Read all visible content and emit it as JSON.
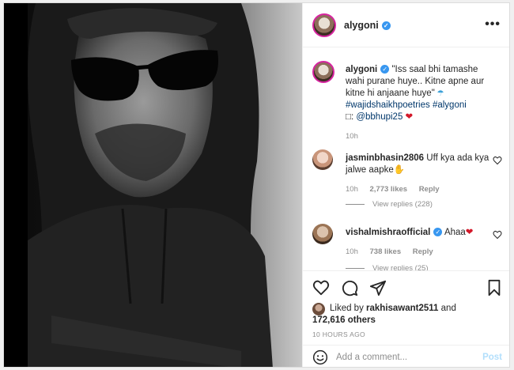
{
  "post": {
    "username": "alygoni",
    "more_icon": "more-dots-icon",
    "verified_icon": "verified-badge-icon"
  },
  "caption": {
    "username": "alygoni",
    "text_line1": "\"Iss saal bhi tamashe wahi purane huye.. Kitne apne aur kitne hi anjaane huye\"",
    "hashtags": "#wajidshaikhpoetries #alygoni",
    "credit_prefix": "□: ",
    "credit_handle": "@bbhupi25",
    "time": "10h"
  },
  "comments": [
    {
      "username": "jasminbhasin2806",
      "text": "Uff kya ada kya jalwe aapke",
      "emoji": "✋",
      "time": "10h",
      "likes": "2,773 likes",
      "reply": "Reply",
      "view_replies": "View replies (228)"
    },
    {
      "username": "vishalmishraofficial",
      "text": "Ahaa",
      "emoji": "❤",
      "time": "10h",
      "likes": "738 likes",
      "reply": "Reply",
      "view_replies": "View replies (25)"
    }
  ],
  "actions": {
    "liked_by_prefix": "Liked by ",
    "liked_by_user": "rakhisawant2511",
    "liked_by_and": " and",
    "others": "172,616 others",
    "time_ago": "10 HOURS AGO"
  },
  "add_comment": {
    "placeholder": "Add a comment...",
    "post_label": "Post",
    "emoji_icon": "smiley-icon"
  },
  "colors": {
    "link": "#00376b",
    "verified": "#3897f0",
    "post_disabled": "#b2dffc",
    "heart": "#d3192a"
  }
}
